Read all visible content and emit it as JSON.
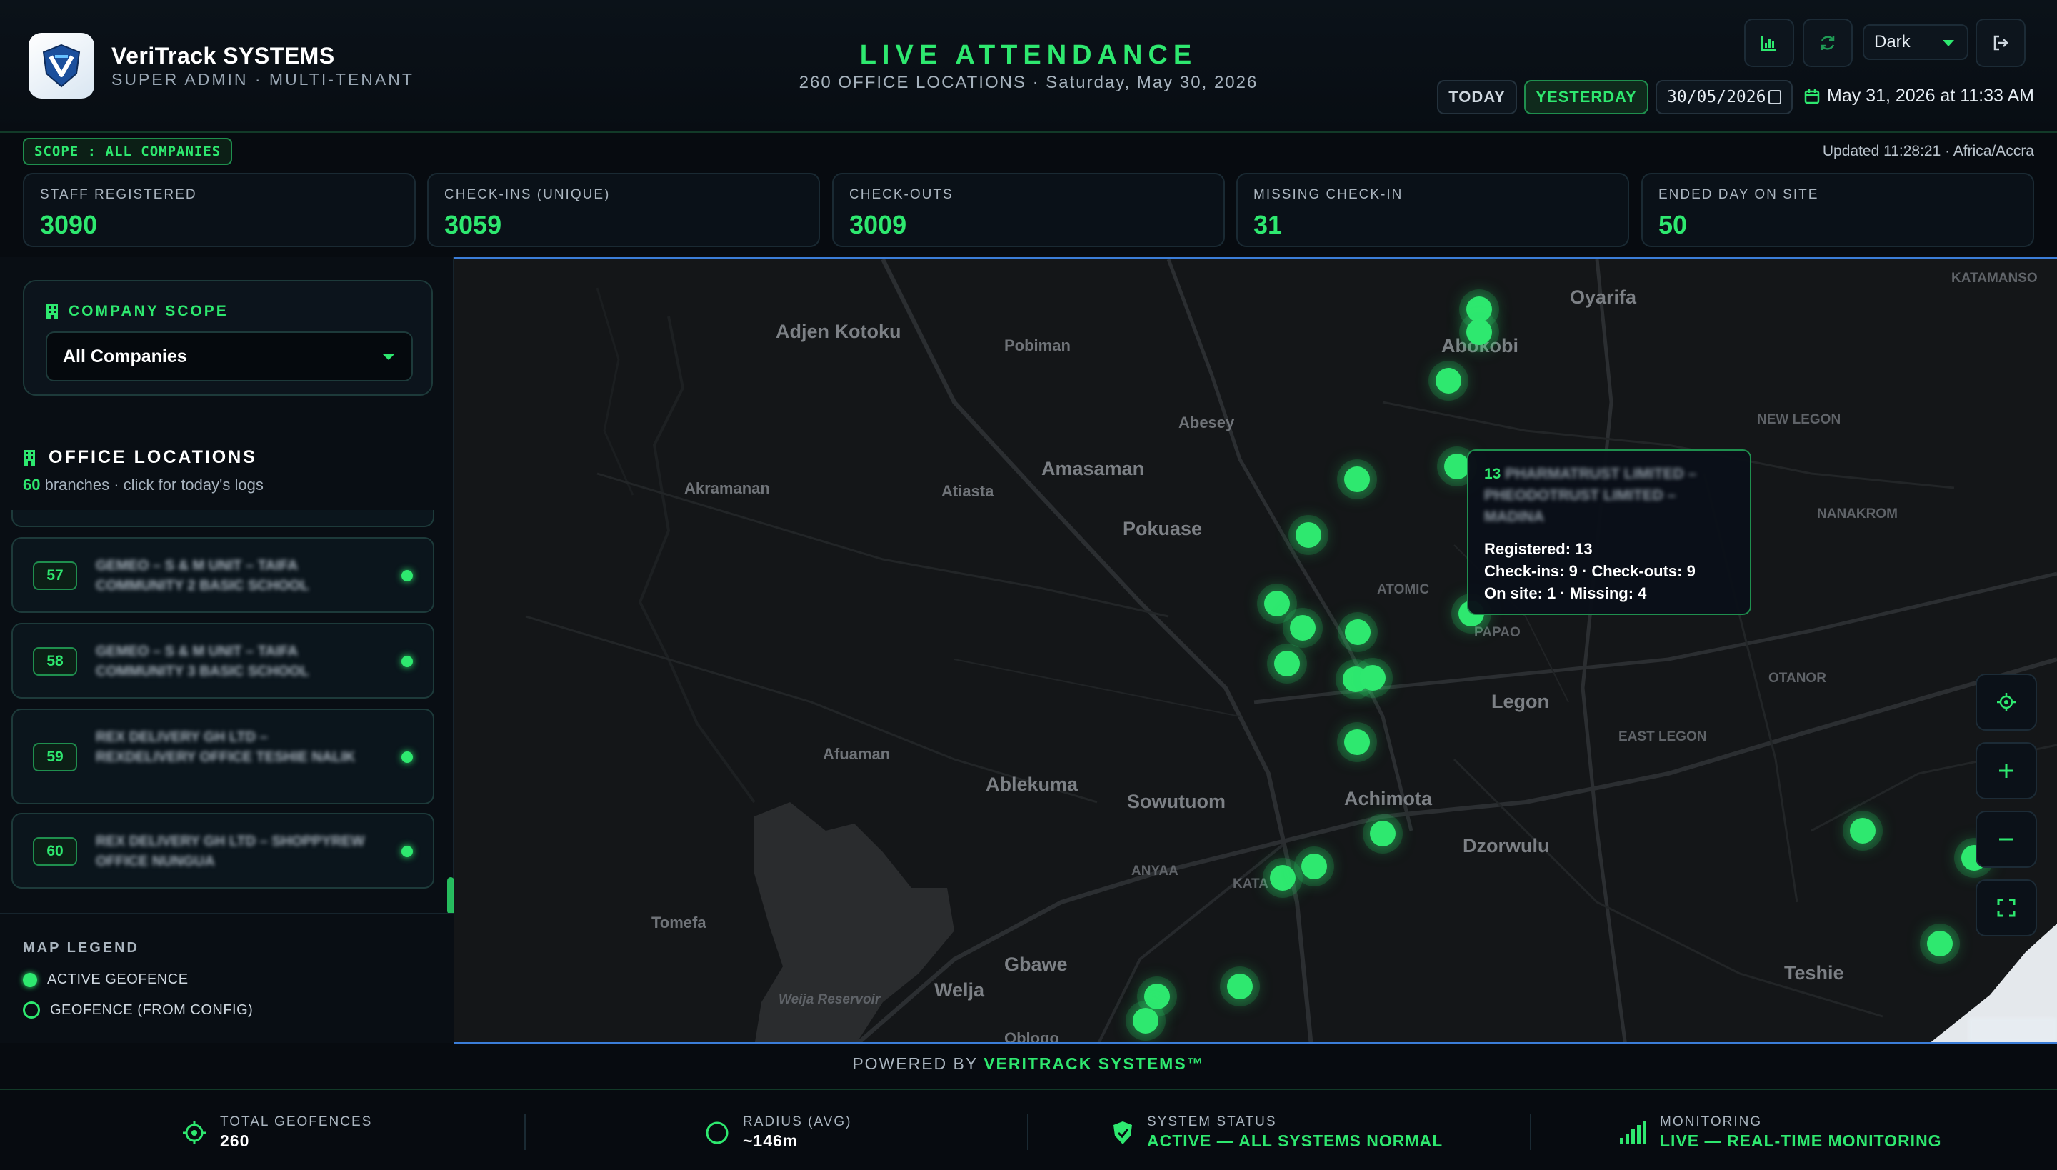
{
  "brand": {
    "name": "VeriTrack SYSTEMS",
    "subtitle": "SUPER ADMIN · MULTI-TENANT",
    "logo_icon": "veritrack-shield-logo"
  },
  "header": {
    "title": "LIVE ATTENDANCE",
    "subtitle": "260 OFFICE LOCATIONS · Saturday, May 30, 2026",
    "theme_value": "Dark",
    "today_label": "TODAY",
    "yesterday_label": "YESTERDAY",
    "date_value": "30/05/2026",
    "now_text": "May 31, 2026 at 11:33 AM",
    "icons": [
      "bar-chart-icon",
      "refresh-icon",
      "logout-icon"
    ]
  },
  "scope": {
    "badge": "SCOPE : ALL COMPANIES",
    "updated": "Updated 11:28:21 · Africa/Accra"
  },
  "stats": [
    {
      "label": "STAFF REGISTERED",
      "value": "3090"
    },
    {
      "label": "CHECK-INS (UNIQUE)",
      "value": "3059"
    },
    {
      "label": "CHECK-OUTS",
      "value": "3009"
    },
    {
      "label": "MISSING CHECK-IN",
      "value": "31"
    },
    {
      "label": "ENDED DAY ON SITE",
      "value": "50"
    }
  ],
  "sidebar": {
    "company_scope_title": "COMPANY SCOPE",
    "company_selected": "All Companies",
    "locations_title": "OFFICE LOCATIONS",
    "locations_count": "60",
    "locations_sub": " branches · click for today's logs",
    "items": [
      {
        "num": "57",
        "name": "GEMEO – S & M UNIT – TAIFA COMMUNITY 2 BASIC SCHOOL"
      },
      {
        "num": "58",
        "name": "GEMEO – S & M UNIT – TAIFA COMMUNITY 3 BASIC SCHOOL"
      },
      {
        "num": "59",
        "name": "REX DELIVERY GH LTD – REXDELIVERY OFFICE TESHIE NALIK"
      },
      {
        "num": "60",
        "name": "REX DELIVERY GH LTD – SHOPPYREW OFFICE NUNGUA"
      }
    ],
    "legend_title": "MAP LEGEND",
    "legend_active": "ACTIVE GEOFENCE",
    "legend_config": "GEOFENCE (FROM CONFIG)"
  },
  "map": {
    "places": [
      {
        "name": "Adjen Kotoku",
        "size": "lg"
      },
      {
        "name": "Pobiman",
        "size": "md"
      },
      {
        "name": "Oyarifa",
        "size": "lg"
      },
      {
        "name": "Abokobi",
        "size": "lg"
      },
      {
        "name": "KATAMANSO",
        "size": "sm"
      },
      {
        "name": "Abesey",
        "size": "md"
      },
      {
        "name": "NEW LEGON",
        "size": "sm"
      },
      {
        "name": "Amasaman",
        "size": "lg"
      },
      {
        "name": "Akramanan",
        "size": "md"
      },
      {
        "name": "Atiasta",
        "size": "md"
      },
      {
        "name": "Pokuase",
        "size": "lg"
      },
      {
        "name": "NANAKROM",
        "size": "sm"
      },
      {
        "name": "ATOMIC",
        "size": "sm"
      },
      {
        "name": "PAPAO",
        "size": "sm"
      },
      {
        "name": "OTANOR",
        "size": "sm"
      },
      {
        "name": "Legon",
        "size": "lg"
      },
      {
        "name": "EAST LEGON",
        "size": "sm"
      },
      {
        "name": "Afuaman",
        "size": "md"
      },
      {
        "name": "Ablekuma",
        "size": "lg"
      },
      {
        "name": "Sowutuom",
        "size": "lg"
      },
      {
        "name": "Achimota",
        "size": "lg"
      },
      {
        "name": "Dzorwulu",
        "size": "lg"
      },
      {
        "name": "ANYAA",
        "size": "sm"
      },
      {
        "name": "KATA",
        "size": "sm"
      },
      {
        "name": "Tomefa",
        "size": "md"
      },
      {
        "name": "Gbawe",
        "size": "lg"
      },
      {
        "name": "Welja",
        "size": "lg"
      },
      {
        "name": "Weija Reservoir",
        "size": "sm"
      },
      {
        "name": "Oblogo",
        "size": "md"
      },
      {
        "name": "Teshie",
        "size": "lg"
      }
    ],
    "tooltip": {
      "num": "13",
      "name": "PHARMATRUST LIMITED – PHEODOTRUST LIMITED – MADINA",
      "registered": "Registered: 13",
      "checks": "Check-ins: 9 · Check-outs: 9",
      "onsite": "On site: 1 · Missing: 4"
    },
    "controls": [
      "locate-icon",
      "zoom-in-icon",
      "zoom-out-icon",
      "fullscreen-icon"
    ]
  },
  "powered": {
    "prefix": "POWERED BY ",
    "brand": "VERITRACK SYSTEMS™"
  },
  "footer": [
    {
      "label": "TOTAL GEOFENCES",
      "value": "260",
      "icon": "crosshair-icon"
    },
    {
      "label": "RADIUS (AVG)",
      "value": "~146m",
      "icon": "circle-icon"
    },
    {
      "label": "SYSTEM STATUS",
      "value": "ACTIVE — ALL SYSTEMS NORMAL",
      "icon": "shield-check-icon"
    },
    {
      "label": "MONITORING",
      "value": "LIVE — REAL-TIME MONITORING",
      "icon": "signal-bars-icon"
    }
  ],
  "colors": {
    "accent": "#2ee86f",
    "background": "#070b10",
    "panel": "#0a1118",
    "map_border": "#3b7dd8"
  }
}
